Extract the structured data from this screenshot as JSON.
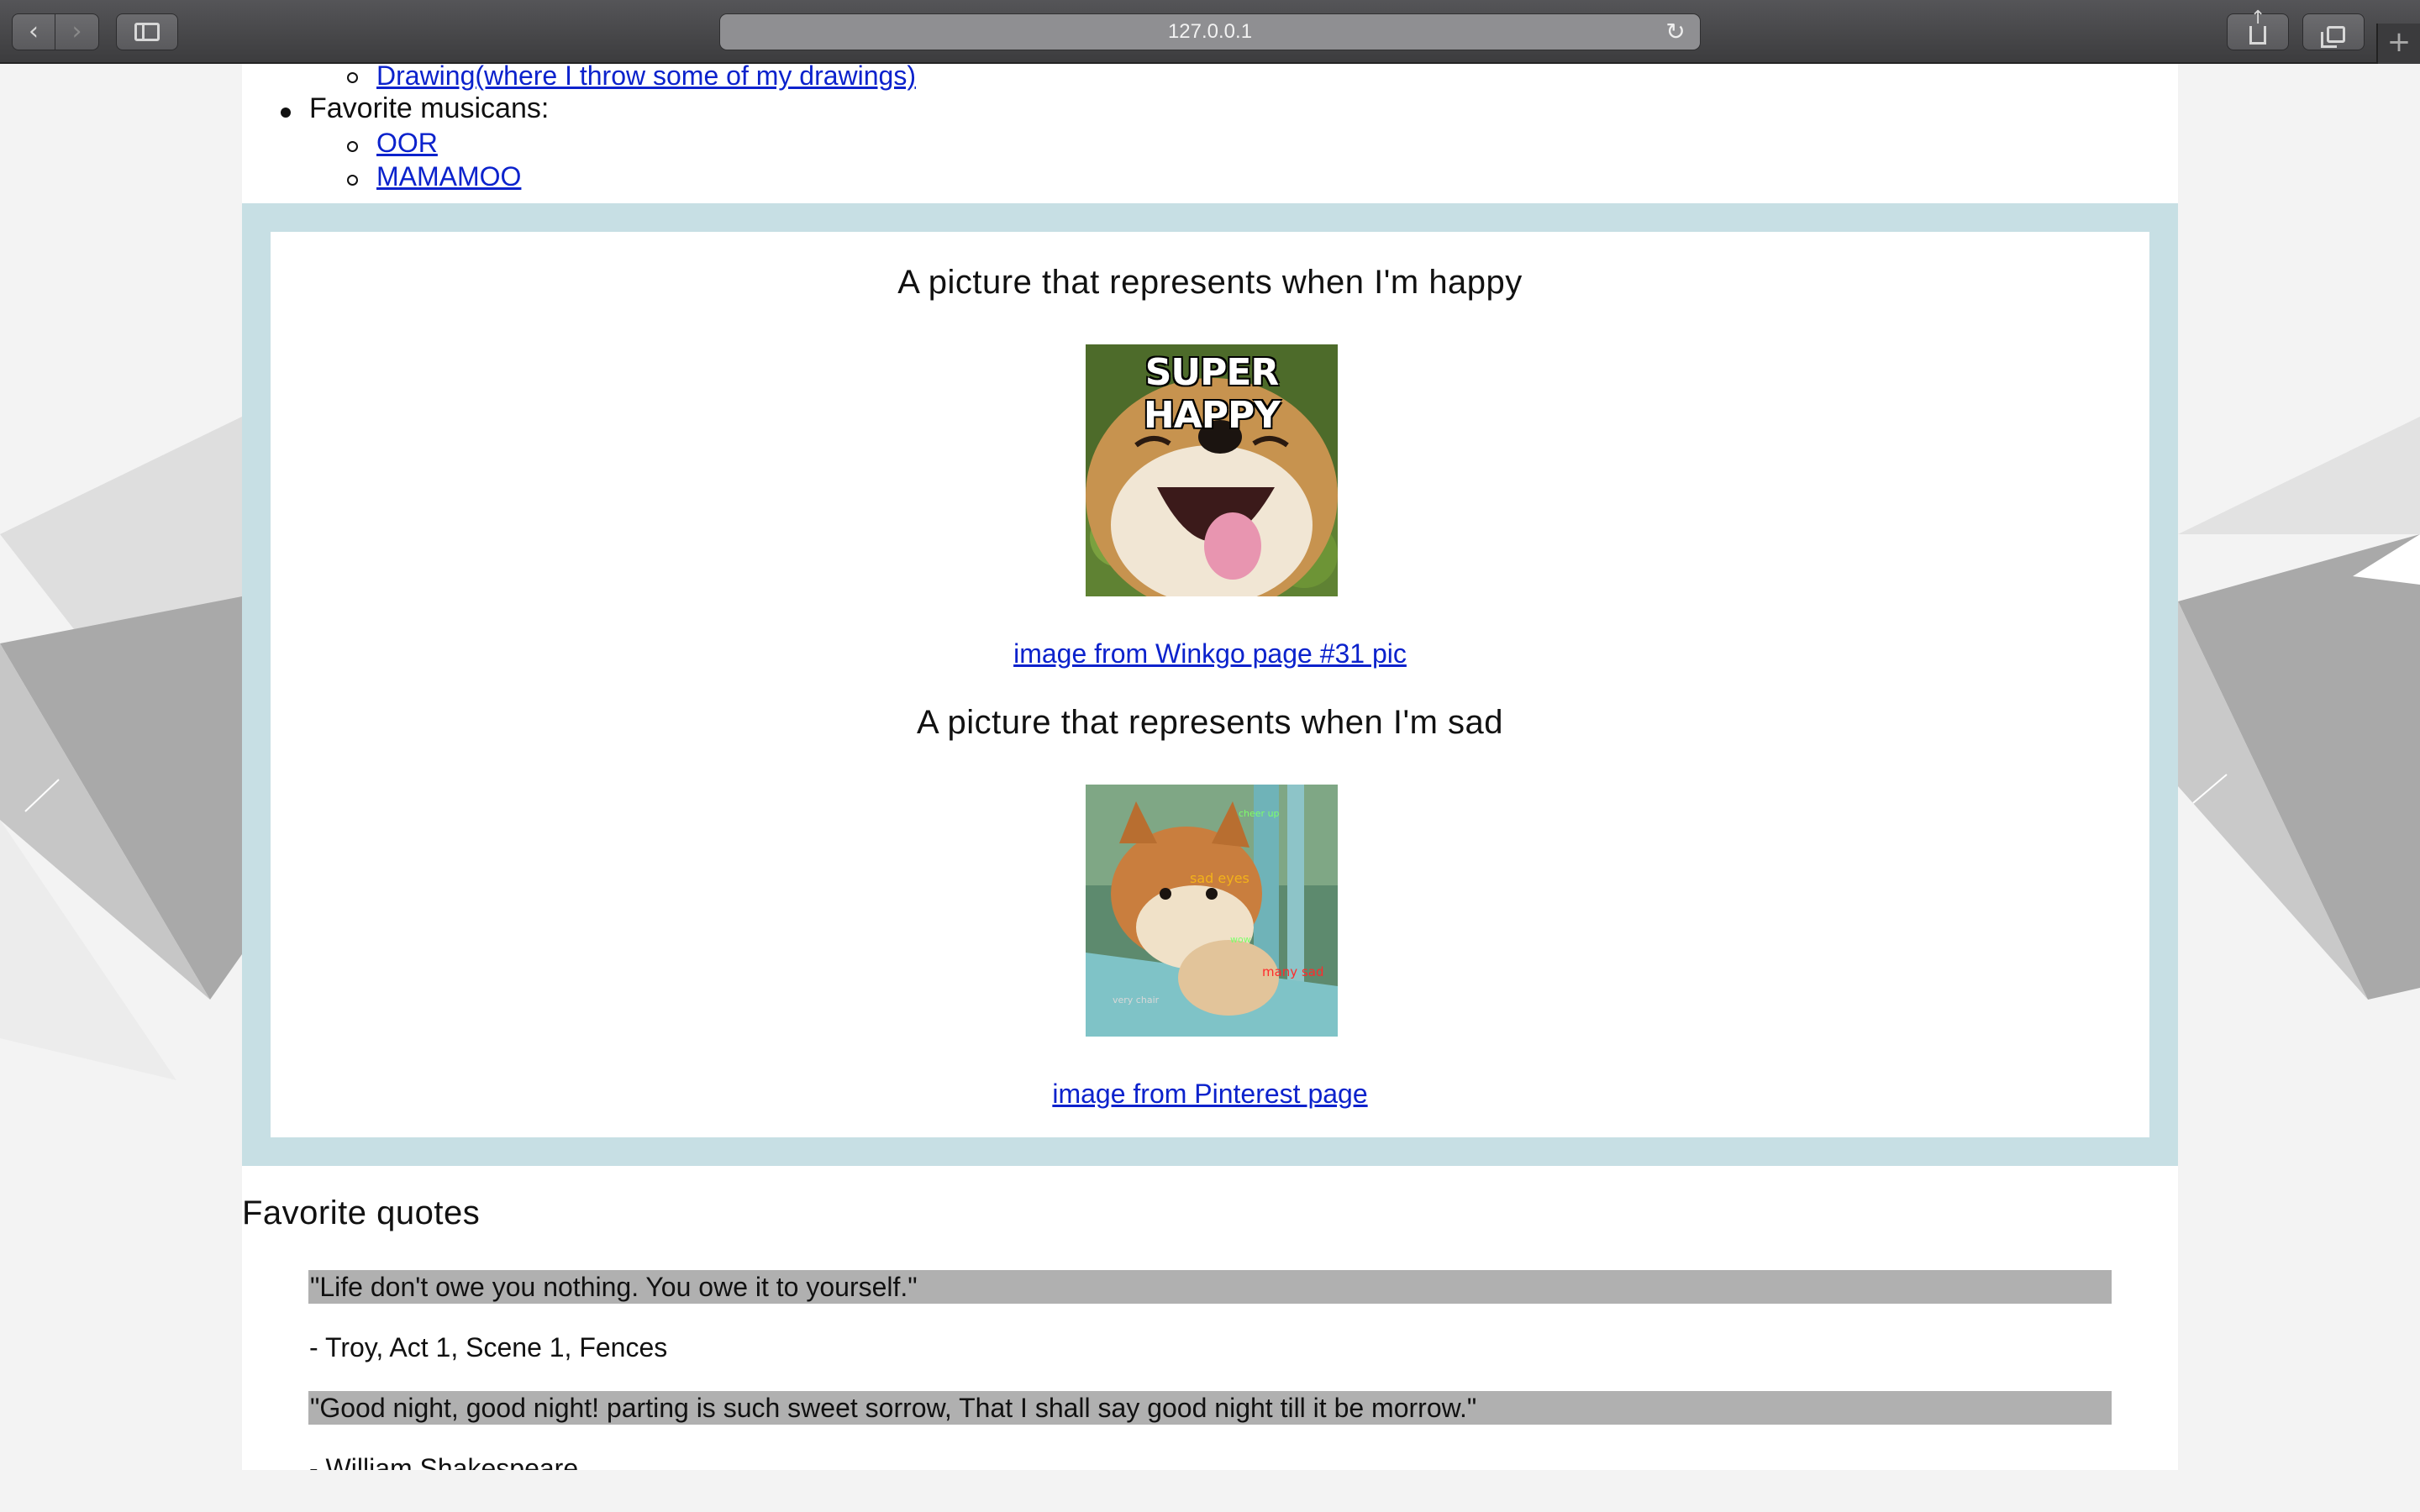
{
  "browser": {
    "url": "127.0.0.1",
    "back_glyph": "‹",
    "forward_glyph": "›",
    "reload_glyph": "↻",
    "newtab_glyph": "+"
  },
  "top_list": {
    "partial_link": "Drawing(where I throw some of my drawings)",
    "musicians_label": "Favorite musicans:",
    "musicians": [
      "OOR",
      "MAMAMOO"
    ]
  },
  "pictures": {
    "happy_heading": "A picture that represents when I'm happy",
    "happy_image_text": "SUPER HAPPY",
    "happy_caption": "image from Winkgo page #31 pic",
    "sad_heading": "A picture that represents when I'm sad",
    "sad_image_texts": [
      "cheer up",
      "sad eyes",
      "wow",
      "many sad",
      "very chair"
    ],
    "sad_caption": "image from Pinterest page"
  },
  "quotes": {
    "title": "Favorite quotes",
    "items": [
      {
        "text": "\"Life don't owe you nothing. You owe it to yourself.\"",
        "attribution": "- Troy, Act 1, Scene 1, Fences"
      },
      {
        "text": "\"Good night, good night! parting is such sweet sorrow, That I shall say good night till it be morrow.\"",
        "attribution": "- William Shakespeare"
      }
    ]
  },
  "colors": {
    "frame": "#c7dfe4",
    "link": "#0b22cc",
    "quote_highlight": "#b0b0b0"
  }
}
